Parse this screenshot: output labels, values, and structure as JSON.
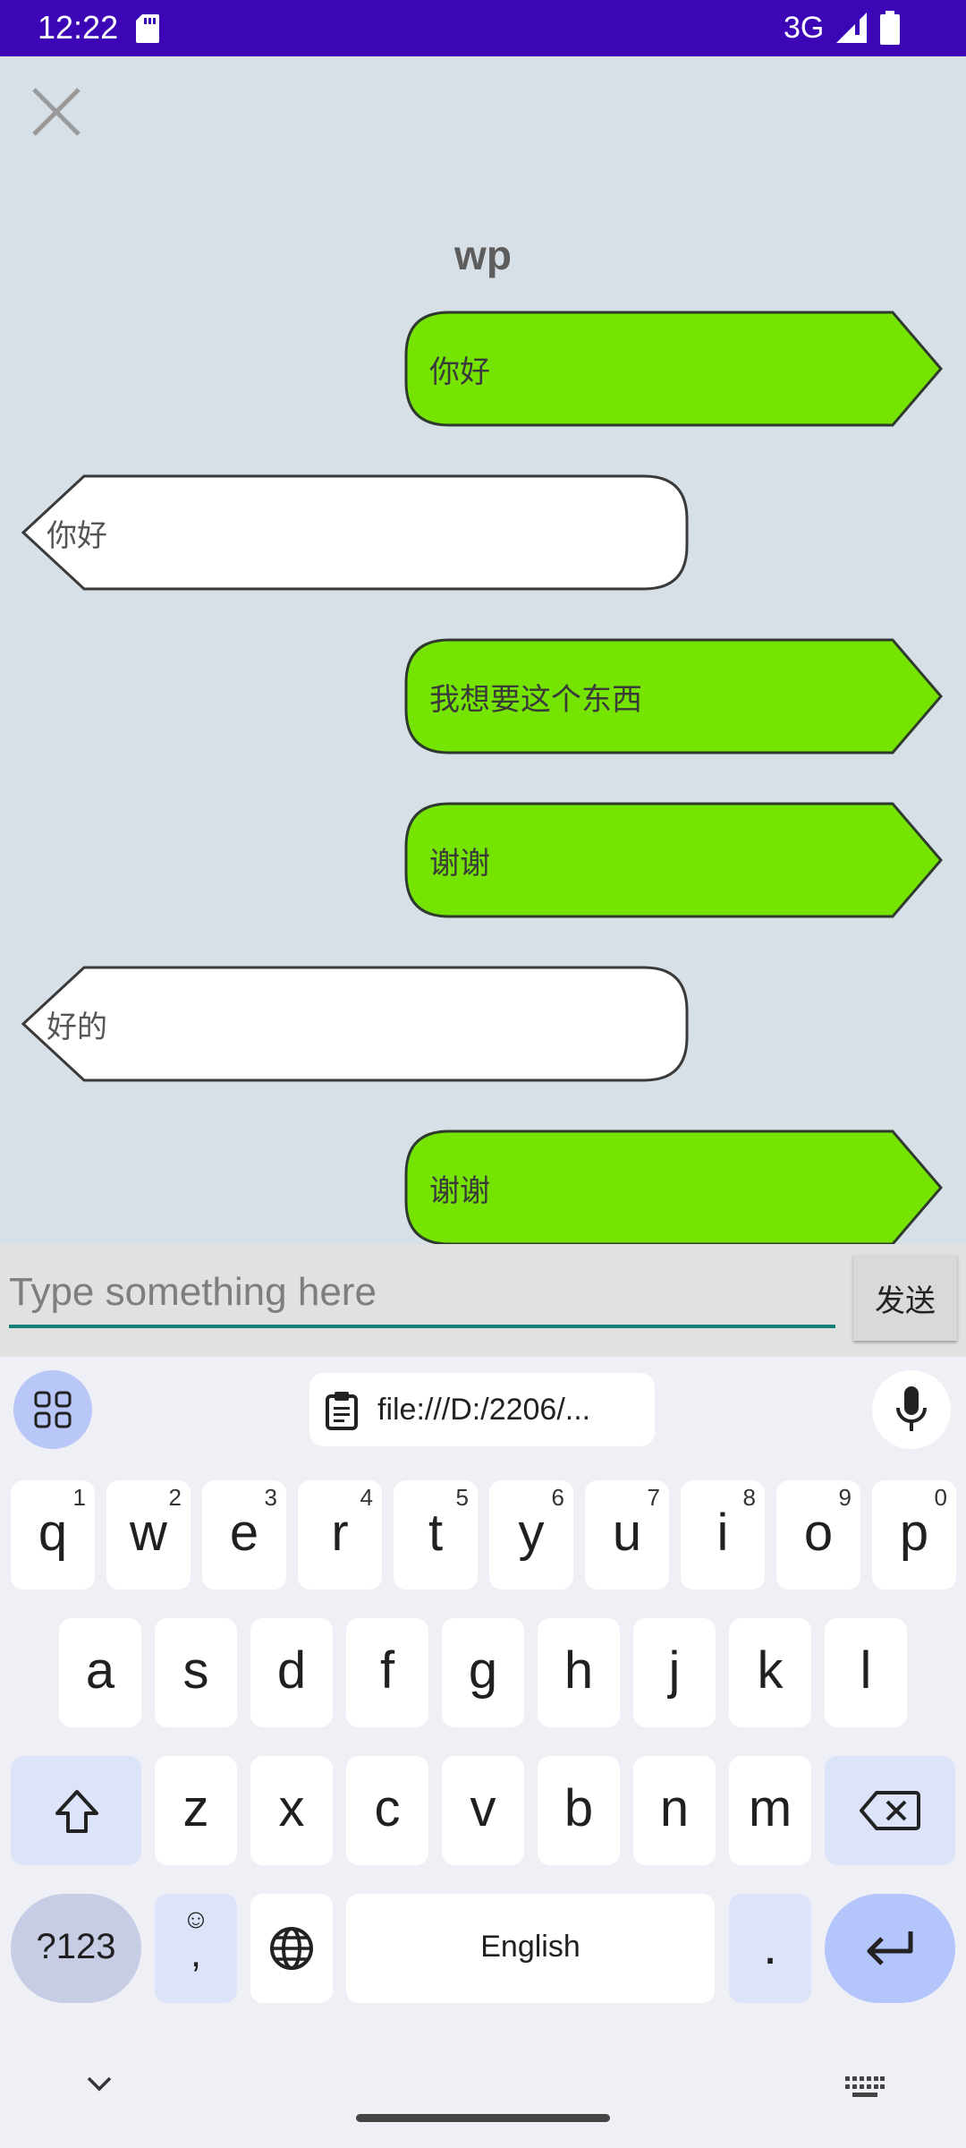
{
  "status_bar": {
    "time": "12:22",
    "network": "3G",
    "icons": [
      "sd-card-icon",
      "signal-icon",
      "battery-icon"
    ],
    "background": "#3c05b5"
  },
  "chat": {
    "close_icon": "close-icon",
    "title": "wp",
    "messages": [
      {
        "side": "right",
        "text": "你好"
      },
      {
        "side": "left",
        "text": "你好"
      },
      {
        "side": "right",
        "text": "我想要这个东西"
      },
      {
        "side": "right",
        "text": "谢谢"
      },
      {
        "side": "left",
        "text": "好的"
      },
      {
        "side": "right",
        "text": "谢谢"
      }
    ],
    "sent_bubble_color": "#74e400",
    "received_bubble_color": "#ffffff"
  },
  "composer": {
    "placeholder": "Type something here",
    "value": "",
    "send_label": "发送",
    "underline_color": "#14807a"
  },
  "keyboard": {
    "clipboard_chip": "file:///D:/2206/...",
    "row1": [
      {
        "key": "q",
        "hint": "1"
      },
      {
        "key": "w",
        "hint": "2"
      },
      {
        "key": "e",
        "hint": "3"
      },
      {
        "key": "r",
        "hint": "4"
      },
      {
        "key": "t",
        "hint": "5"
      },
      {
        "key": "y",
        "hint": "6"
      },
      {
        "key": "u",
        "hint": "7"
      },
      {
        "key": "i",
        "hint": "8"
      },
      {
        "key": "o",
        "hint": "9"
      },
      {
        "key": "p",
        "hint": "0"
      }
    ],
    "row2": [
      "a",
      "s",
      "d",
      "f",
      "g",
      "h",
      "j",
      "k",
      "l"
    ],
    "row3": [
      "z",
      "x",
      "c",
      "v",
      "b",
      "n",
      "m"
    ],
    "symbols_label": "?123",
    "emoji_top": "☺",
    "emoji_bottom": ",",
    "space_label": "English",
    "period_label": ".",
    "accent_color": "#b3c5fb"
  }
}
